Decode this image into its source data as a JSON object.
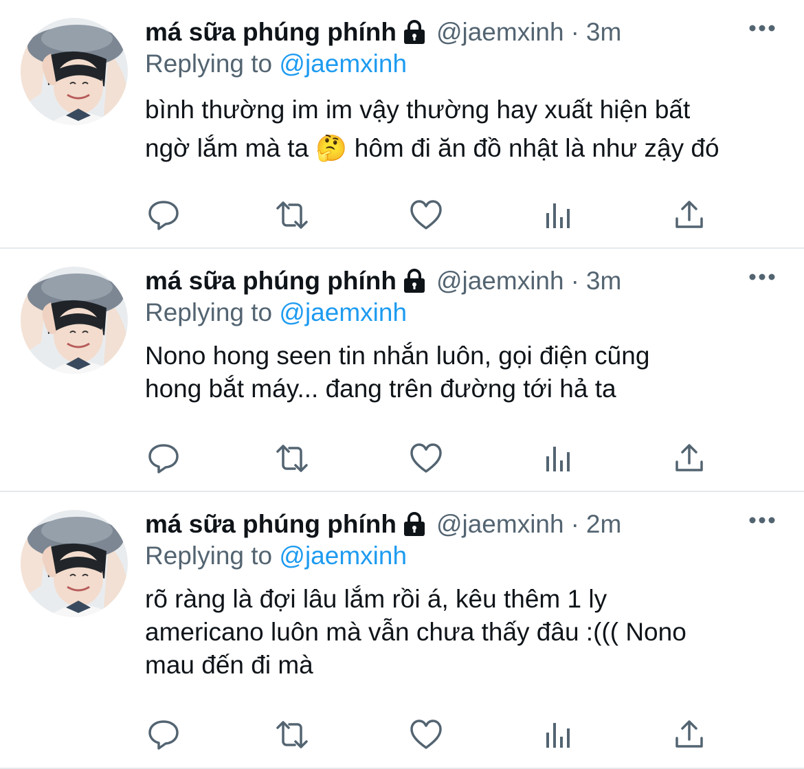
{
  "colors": {
    "text": "#0f1419",
    "secondary": "#536471",
    "link": "#1d9bf0",
    "icon": "#536471",
    "divider": "#e6e9ec"
  },
  "tweets": [
    {
      "author_name": "má sữa phúng phính",
      "protected_icon": "lock-icon",
      "handle": "@jaemxinh",
      "separator": "·",
      "time": "3m",
      "replying_prefix": "Replying to",
      "replying_to": "@jaemxinh",
      "text_line1": "bình thường im im vậy thường hay xuất hiện bất",
      "text_line2": "ngờ lắm mà ta 🤔 hôm đi ăn đồ nhật là như zậy đó",
      "text_line3": ""
    },
    {
      "author_name": "má sữa phúng phính",
      "protected_icon": "lock-icon",
      "handle": "@jaemxinh",
      "separator": "·",
      "time": "3m",
      "replying_prefix": "Replying to",
      "replying_to": "@jaemxinh",
      "text_line1": "Nono hong seen tin nhắn luôn, gọi điện cũng",
      "text_line2": "hong bắt máy... đang trên đường tới hả ta",
      "text_line3": ""
    },
    {
      "author_name": "má sữa phúng phính",
      "protected_icon": "lock-icon",
      "handle": "@jaemxinh",
      "separator": "·",
      "time": "2m",
      "replying_prefix": "Replying to",
      "replying_to": "@jaemxinh",
      "text_line1": "rõ ràng là đợi lâu lắm rồi á, kêu thêm 1 ly",
      "text_line2": "americano luôn mà vẫn chưa thấy đâu :((( Nono",
      "text_line3": "mau đến đi mà"
    }
  ],
  "action_icons": [
    "reply-icon",
    "retweet-icon",
    "like-icon",
    "analytics-icon",
    "share-icon"
  ]
}
